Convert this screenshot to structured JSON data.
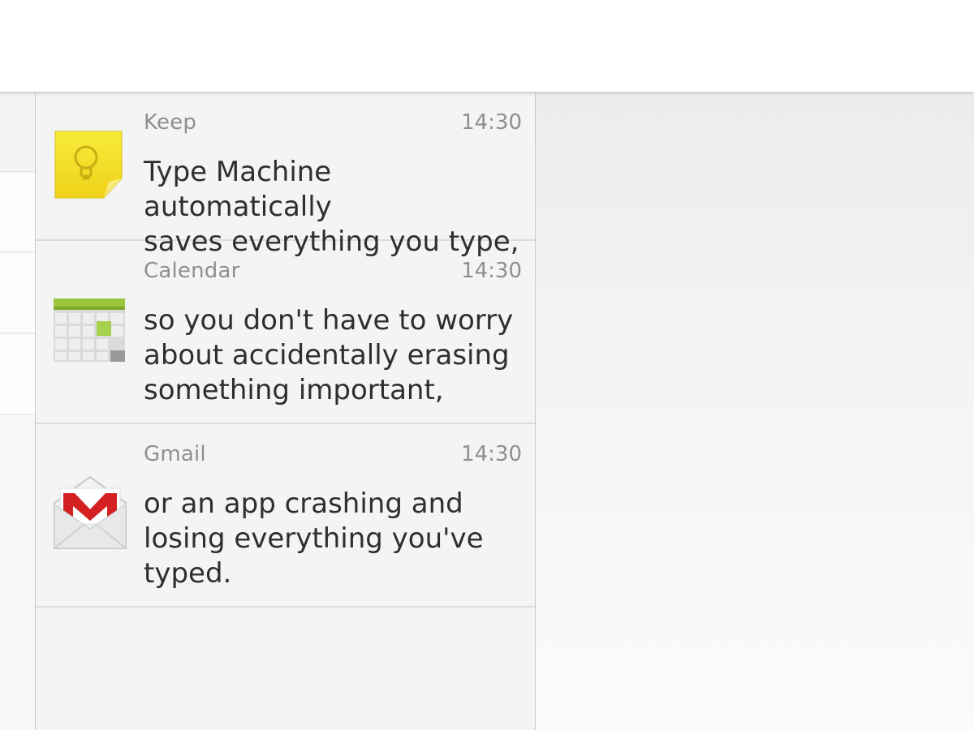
{
  "notifications": [
    {
      "app": "Keep",
      "time": "14:30",
      "icon": "keep-icon",
      "message": "Type Machine automatically\nsaves everything you type,"
    },
    {
      "app": "Calendar",
      "time": "14:30",
      "icon": "calendar-icon",
      "message": "so you don't have to worry\nabout accidentally erasing\nsomething important,"
    },
    {
      "app": "Gmail",
      "time": "14:30",
      "icon": "gmail-icon",
      "message": "or an app crashing and\nlosing everything you've\ntyped."
    }
  ],
  "colors": {
    "keep_yellow": "#f3e227",
    "calendar_green": "#9bc53a",
    "gmail_red": "#d42020"
  }
}
